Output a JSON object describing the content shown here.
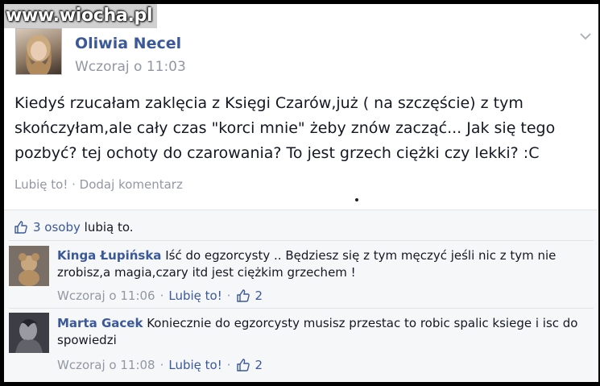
{
  "watermark": "www.wiocha.pl",
  "post": {
    "author": "Oliwia Necel",
    "time": "Wczoraj o 11:03",
    "text_lines": [
      "Kiedyś rzucałam zaklęcia z Księgi Czarów,już ( na szczęście) z tym",
      "skończyłam,ale cały czas \"korci mnie\" żeby znów zacząć... Jak się tego",
      "pozbyć? tej ochoty do czarowania? To jest grzech ciężki czy lekki? :C"
    ],
    "like_label": "Lubię to!",
    "separator": " · ",
    "comment_label": "Dodaj komentarz"
  },
  "likes": {
    "count_text": "3 osoby",
    "suffix": "lubią to."
  },
  "comments": [
    {
      "author": "Kinga Łupińska",
      "text": "Iść do egzorcysty .. Będziesz się z tym męczyć jeśli nic z tym nie zrobisz,a magia,czary itd jest ciężkim grzechem !",
      "time": "Wczoraj o 11:06",
      "sep": "·",
      "like_label": "Lubię to!",
      "likes": "2"
    },
    {
      "author": "Marta Gacek",
      "text": "Koniecznie do egzorcysty musisz przestac to robic spalic ksiege i isc do spowiedzi",
      "time": "Wczoraj o 11:08",
      "sep": "·",
      "like_label": "Lubię to!",
      "likes": "2"
    }
  ],
  "colors": {
    "link": "#3b5998",
    "meta": "#9197a3",
    "feedback_bg": "#f6f7f9"
  }
}
